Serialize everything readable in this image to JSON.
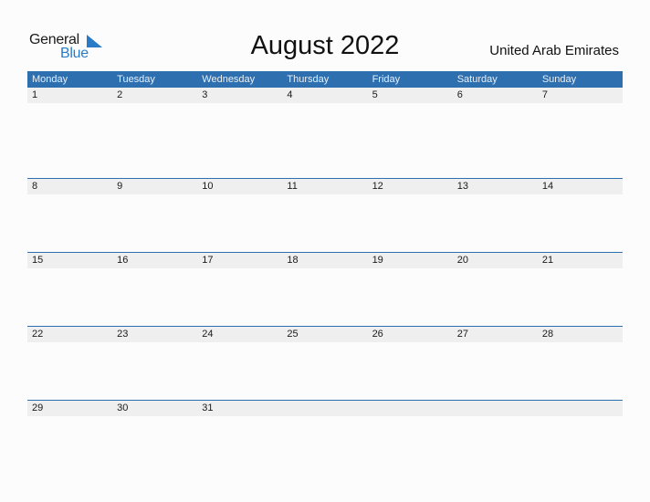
{
  "logo": {
    "word1": "General",
    "word2": "Blue"
  },
  "title": "August 2022",
  "country": "United Arab Emirates",
  "colors": {
    "accent": "#2e6fb0",
    "row_bg": "#efefef",
    "logo_blue": "#2a7bc6"
  },
  "weekdays": [
    "Monday",
    "Tuesday",
    "Wednesday",
    "Thursday",
    "Friday",
    "Saturday",
    "Sunday"
  ],
  "weeks": [
    [
      "1",
      "2",
      "3",
      "4",
      "5",
      "6",
      "7"
    ],
    [
      "8",
      "9",
      "10",
      "11",
      "12",
      "13",
      "14"
    ],
    [
      "15",
      "16",
      "17",
      "18",
      "19",
      "20",
      "21"
    ],
    [
      "22",
      "23",
      "24",
      "25",
      "26",
      "27",
      "28"
    ],
    [
      "29",
      "30",
      "31",
      "",
      "",
      "",
      ""
    ]
  ]
}
